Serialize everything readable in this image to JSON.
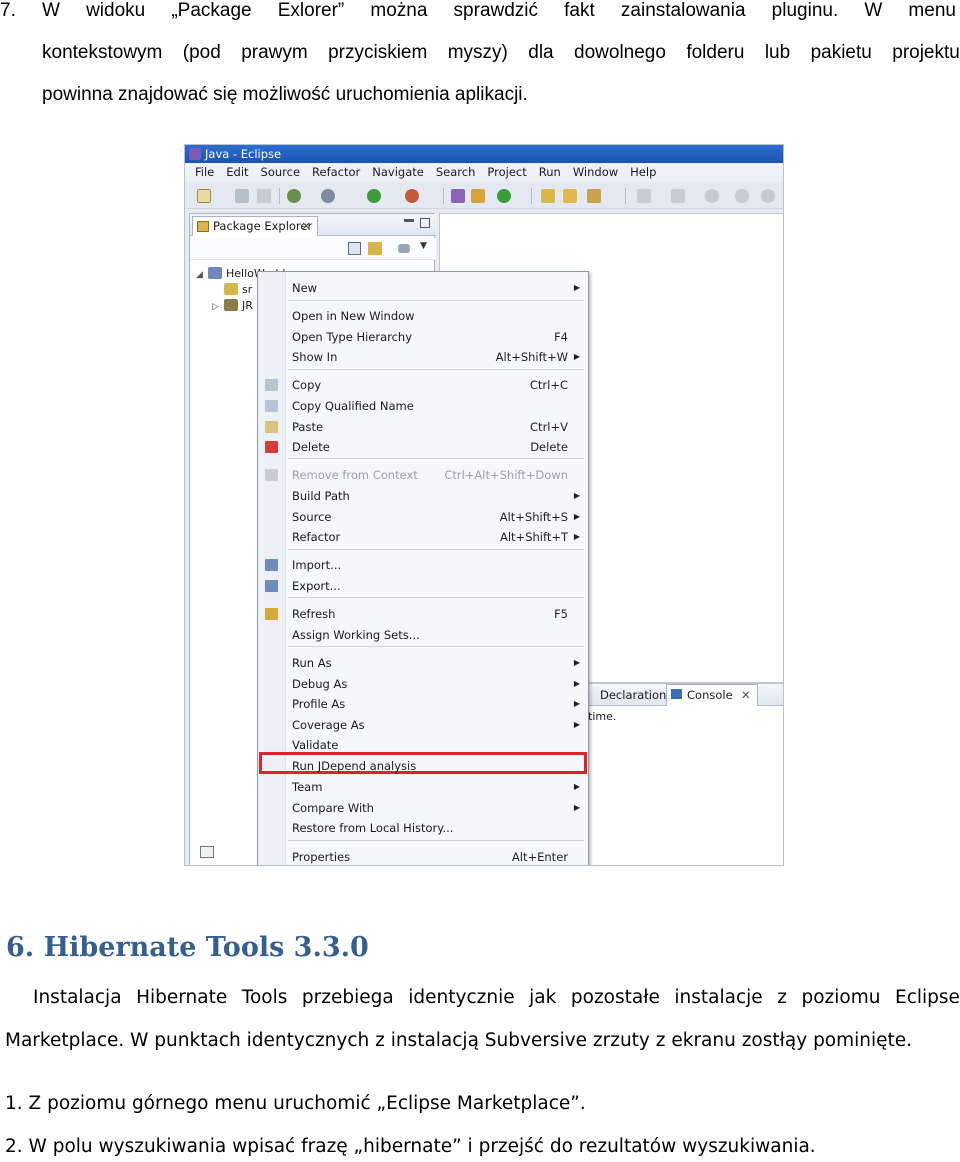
{
  "para7": {
    "number": "7.",
    "line1": [
      "W",
      "widoku",
      "„Package",
      "Exlorer”",
      "można",
      "sprawdzić",
      "fakt",
      "zainstalowania",
      "pluginu.",
      "W",
      "menu"
    ],
    "line2": [
      "kontekstowym",
      "(pod",
      "prawym",
      "przyciskiem",
      "myszy)",
      "dla",
      "dowolnego",
      "folderu",
      "lub",
      "pakietu",
      "projektu"
    ],
    "line3": "powinna znajdować się możliwość uruchomienia aplikacji."
  },
  "screenshot": {
    "window_title": "Java - Eclipse",
    "menu": [
      "File",
      "Edit",
      "Source",
      "Refactor",
      "Navigate",
      "Search",
      "Project",
      "Run",
      "Window",
      "Help"
    ],
    "package_explorer_tab": "Package Explorer",
    "tab_close": "✕",
    "tree": [
      {
        "toggle": "◢",
        "label": "HelloWorld"
      },
      {
        "toggle": "",
        "label": "sr"
      },
      {
        "toggle": "▷",
        "label": "JR"
      }
    ],
    "bottom_tabs": {
      "declaration": "Declaration",
      "console": "Console"
    },
    "bottom_text": "time.",
    "context_menu": [
      {
        "label": "New",
        "shortcut": "",
        "arrow": "▶"
      },
      {
        "label": "Open in New Window",
        "shortcut": "",
        "arrow": ""
      },
      {
        "label": "Open Type Hierarchy",
        "shortcut": "F4",
        "arrow": ""
      },
      {
        "label": "Show In",
        "shortcut": "Alt+Shift+W",
        "arrow": "▶"
      },
      {
        "label": "Copy",
        "shortcut": "Ctrl+C",
        "arrow": ""
      },
      {
        "label": "Copy Qualified Name",
        "shortcut": "",
        "arrow": ""
      },
      {
        "label": "Paste",
        "shortcut": "Ctrl+V",
        "arrow": ""
      },
      {
        "label": "Delete",
        "shortcut": "Delete",
        "arrow": ""
      },
      {
        "label": "Remove from Context",
        "shortcut": "Ctrl+Alt+Shift+Down",
        "arrow": ""
      },
      {
        "label": "Build Path",
        "shortcut": "",
        "arrow": "▶"
      },
      {
        "label": "Source",
        "shortcut": "Alt+Shift+S",
        "arrow": "▶"
      },
      {
        "label": "Refactor",
        "shortcut": "Alt+Shift+T",
        "arrow": "▶"
      },
      {
        "label": "Import...",
        "shortcut": "",
        "arrow": ""
      },
      {
        "label": "Export...",
        "shortcut": "",
        "arrow": ""
      },
      {
        "label": "Refresh",
        "shortcut": "F5",
        "arrow": ""
      },
      {
        "label": "Assign Working Sets...",
        "shortcut": "",
        "arrow": ""
      },
      {
        "label": "Run As",
        "shortcut": "",
        "arrow": "▶"
      },
      {
        "label": "Debug As",
        "shortcut": "",
        "arrow": "▶"
      },
      {
        "label": "Profile As",
        "shortcut": "",
        "arrow": "▶"
      },
      {
        "label": "Coverage As",
        "shortcut": "",
        "arrow": "▶"
      },
      {
        "label": "Validate",
        "shortcut": "",
        "arrow": ""
      },
      {
        "label": "Run JDepend analysis",
        "shortcut": "",
        "arrow": ""
      },
      {
        "label": "Team",
        "shortcut": "",
        "arrow": "▶"
      },
      {
        "label": "Compare With",
        "shortcut": "",
        "arrow": "▶"
      },
      {
        "label": "Restore from Local History...",
        "shortcut": "",
        "arrow": ""
      },
      {
        "label": "Properties",
        "shortcut": "Alt+Enter",
        "arrow": ""
      }
    ]
  },
  "section6": {
    "heading": "6. Hibernate Tools 3.3.0",
    "para_line1": [
      "Instalacja",
      "Hibernate",
      "Tools",
      "przebiega",
      "identycznie",
      "jak",
      "pozostałe",
      "instalacje",
      "z",
      "poziomu",
      "Eclipse"
    ],
    "para_line2": "Marketplace. W punktach identycznych z instalacją Subversive zrzuty z ekranu zostłąy pominięte.",
    "step1": "1. Z poziomu górnego menu uruchomić „Eclipse Marketplace”.",
    "step2": "2. W polu wyszukiwania wpisać frazę „hibernate” i przejść do rezultatów wyszukiwania."
  },
  "colors": {
    "heading": "#365f91",
    "highlight_box": "#d9242c",
    "titlebar": "#1b52b0"
  }
}
